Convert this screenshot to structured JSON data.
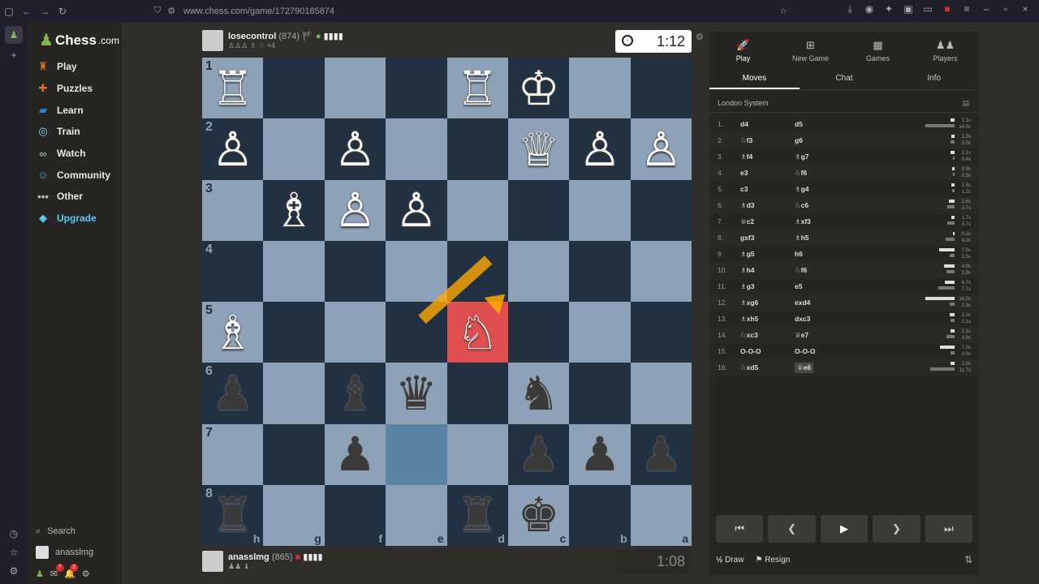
{
  "browser": {
    "url": "www.chess.com/game/172790185874"
  },
  "sidebar": {
    "logo": "Chess",
    "logo_suffix": ".com",
    "items": [
      {
        "label": "Play",
        "icon": "play-icon",
        "color": "#e06a2c"
      },
      {
        "label": "Puzzles",
        "icon": "puzzle-icon",
        "color": "#e0702c"
      },
      {
        "label": "Learn",
        "icon": "learn-icon",
        "color": "#2c8ae0"
      },
      {
        "label": "Train",
        "icon": "train-icon",
        "color": "#8ed0ff"
      },
      {
        "label": "Watch",
        "icon": "binoculars-icon",
        "color": "#8aa"
      },
      {
        "label": "Community",
        "icon": "community-icon",
        "color": "#5ac"
      },
      {
        "label": "Other",
        "icon": "more-icon",
        "color": "#bbb"
      },
      {
        "label": "Upgrade",
        "icon": "diamond-icon",
        "color": "#5ac8fa"
      }
    ],
    "search_label": "Search",
    "username": "anasslmg",
    "notif_count_1": "7",
    "notif_count_2": "2"
  },
  "top_player": {
    "name": "losecontrol",
    "rating": "(874)",
    "captured": "♙♙♙ ♗ ♘ +4"
  },
  "bottom_player": {
    "name": "anasslmg",
    "rating": "(865)",
    "captured": "♟♟ ♝"
  },
  "clocks": {
    "top": "1:12",
    "bottom": "1:08"
  },
  "board": {
    "colors": {
      "light": "#8da2b8",
      "dark": "#223142",
      "last_move_from": "#5b83a3",
      "last_move_to": "#e04f4f",
      "arrow": "#ffaa00"
    },
    "ranks": [
      "1",
      "2",
      "3",
      "4",
      "5",
      "6",
      "7",
      "8"
    ],
    "files": [
      "h",
      "g",
      "f",
      "e",
      "d",
      "c",
      "b",
      "a"
    ],
    "rows": [
      [
        "wR",
        "",
        "",
        "",
        "wR",
        "wK",
        "",
        ""
      ],
      [
        "wP",
        "",
        "wP",
        "",
        "",
        "wQ",
        "wP",
        "wP"
      ],
      [
        "",
        "wB",
        "wP",
        "wP",
        "",
        "",
        "",
        ""
      ],
      [
        "",
        "",
        "",
        "",
        "",
        "",
        "",
        ""
      ],
      [
        "wB",
        "",
        "",
        "",
        "wN",
        "",
        "",
        ""
      ],
      [
        "bP",
        "",
        "bB",
        "bQ",
        "",
        "bN",
        "",
        ""
      ],
      [
        "",
        "",
        "bP",
        "",
        "",
        "bP",
        "bP",
        "bP"
      ],
      [
        "bR",
        "",
        "",
        "",
        "bR",
        "bK",
        "",
        ""
      ]
    ]
  },
  "panel": {
    "tabs": [
      {
        "label": "Play",
        "icon": "rocket-icon"
      },
      {
        "label": "New Game",
        "icon": "plus-icon"
      },
      {
        "label": "Games",
        "icon": "board-icon"
      },
      {
        "label": "Players",
        "icon": "players-icon"
      }
    ],
    "sub_tabs": [
      "Moves",
      "Chat",
      "Info"
    ],
    "opening": "London System",
    "moves": [
      {
        "n": "1.",
        "w": "d4",
        "b": "d5",
        "wt": "2.1s",
        "bt": "14.0s",
        "wf": 0.15,
        "bf": 1.0
      },
      {
        "n": "2.",
        "w": "♘f3",
        "b": "g6",
        "wt": "1.3s",
        "bt": "2.0s",
        "wf": 0.1,
        "bf": 0.15
      },
      {
        "n": "3.",
        "w": "♗f4",
        "b": "♗g7",
        "wt": "2.1s",
        "bt": "0.4s",
        "wf": 0.15,
        "bf": 0.05
      },
      {
        "n": "4.",
        "w": "e3",
        "b": "♘f6",
        "wt": "0.9s",
        "bt": "0.5s",
        "wf": 0.07,
        "bf": 0.05
      },
      {
        "n": "5.",
        "w": "c3",
        "b": "♗g4",
        "wt": "1.5s",
        "bt": "1.2s",
        "wf": 0.11,
        "bf": 0.09
      },
      {
        "n": "6.",
        "w": "♗d3",
        "b": "♘c6",
        "wt": "2.8s",
        "bt": "3.7s",
        "wf": 0.2,
        "bf": 0.26
      },
      {
        "n": "7.",
        "w": "♕c2",
        "b": "♗xf3",
        "wt": "1.7s",
        "bt": "3.7s",
        "wf": 0.12,
        "bf": 0.26
      },
      {
        "n": "8.",
        "w": "gxf3",
        "b": "♗h5",
        "wt": "0.2s",
        "bt": "4.2s",
        "wf": 0.03,
        "bf": 0.3
      },
      {
        "n": "9.",
        "w": "♗g5",
        "b": "h6",
        "wt": "7.5s",
        "bt": "2.5s",
        "wf": 0.54,
        "bf": 0.18
      },
      {
        "n": "10.",
        "w": "♗h4",
        "b": "♘f6",
        "wt": "4.9s",
        "bt": "3.8s",
        "wf": 0.35,
        "bf": 0.27
      },
      {
        "n": "11.",
        "w": "♗g3",
        "b": "e5",
        "wt": "4.7s",
        "bt": "7.7s",
        "wf": 0.34,
        "bf": 0.55
      },
      {
        "n": "12.",
        "w": "♗xg6",
        "b": "exd4",
        "wt": "14.0s",
        "bt": "2.3s",
        "wf": 1.0,
        "bf": 0.16
      },
      {
        "n": "13.",
        "w": "♗xh5",
        "b": "dxc3",
        "wt": "2.2s",
        "bt": "2.1s",
        "wf": 0.16,
        "bf": 0.15
      },
      {
        "n": "14.",
        "w": "♘xc3",
        "b": "♕e7",
        "wt": "2.1s",
        "bt": "3.8s",
        "wf": 0.15,
        "bf": 0.27
      },
      {
        "n": "15.",
        "w": "O-O-O",
        "b": "O-O-O",
        "wt": "7.0s",
        "bt": "2.0s",
        "wf": 0.5,
        "bf": 0.14
      },
      {
        "n": "16.",
        "w": "♘xd5",
        "b": "♕e6",
        "wt": "1.9s",
        "bt": "11.7s",
        "wf": 0.14,
        "bf": 0.84
      }
    ],
    "draw_label": "Draw",
    "resign_label": "Resign"
  }
}
